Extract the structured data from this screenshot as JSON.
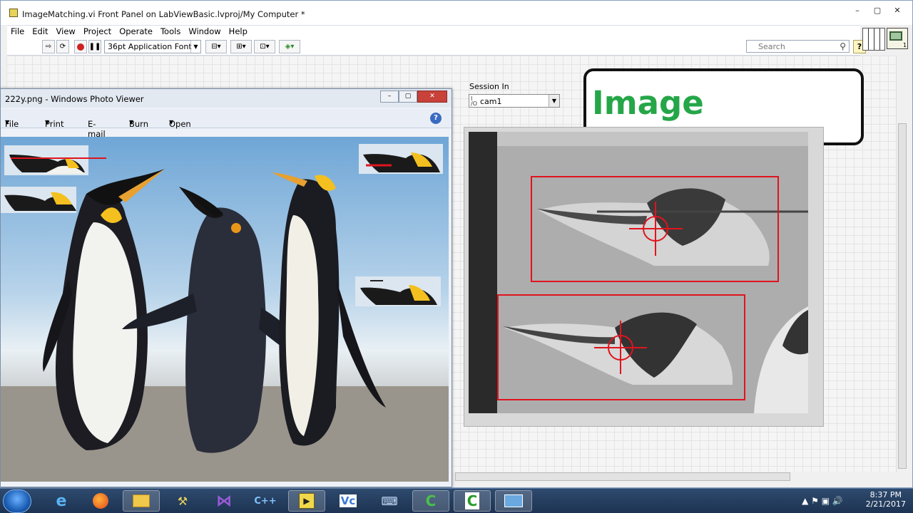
{
  "labview": {
    "window_title": "ImageMatching.vi Front Panel on LabViewBasic.lvproj/My Computer *",
    "menu": [
      "File",
      "Edit",
      "View",
      "Project",
      "Operate",
      "Tools",
      "Window",
      "Help"
    ],
    "font_select": "36pt Application Font",
    "search_placeholder": "Search",
    "help_label": "?",
    "window_buttons": [
      "–",
      "▢",
      "✕"
    ]
  },
  "front_panel": {
    "session_label": "Session In",
    "session_value": "cam1",
    "title_text": "Image Matching"
  },
  "photo_viewer": {
    "title": "222y.png - Windows Photo Viewer",
    "menu": [
      "File",
      "Print",
      "E-mail",
      "Burn",
      "Open"
    ],
    "help_label": "?"
  },
  "taskbar": {
    "apps": [
      "ie-icon",
      "firefox-icon",
      "explorer-folder-icon",
      "labview-tools-icon",
      "visual-studio-icon",
      "cpp-compiler-icon",
      "labview-icon",
      "vs-code-icon",
      "network-icon",
      "camtasia-icon",
      "camtasia-recorder-icon",
      "photo-viewer-icon"
    ],
    "time": "8:37 PM",
    "date": "2/21/2017"
  },
  "colors": {
    "title_green": "#25a648",
    "match_red": "#e0141e",
    "panel_grid": "#e4e4e4"
  }
}
